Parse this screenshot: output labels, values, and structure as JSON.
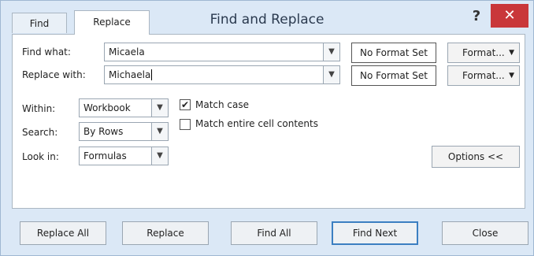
{
  "window": {
    "title": "Find and Replace",
    "help_label": "?",
    "close_label": "✕"
  },
  "tabs": [
    {
      "label": "Find",
      "selected": false
    },
    {
      "label": "Replace",
      "selected": true
    }
  ],
  "form": {
    "find_label": "Find what:",
    "find_value": "Micaela",
    "replace_label": "Replace with:",
    "replace_value": "Michaela",
    "format_status_1": "No Format Set",
    "format_status_2": "No Format Set",
    "format_button_1": "Format...",
    "format_button_2": "Format...",
    "within_label": "Within:",
    "within_value": "Workbook",
    "search_label": "Search:",
    "search_value": "By Rows",
    "lookin_label": "Look in:",
    "lookin_value": "Formulas",
    "match_case_label": "Match case",
    "match_case_checked": true,
    "match_entire_label": "Match entire cell contents",
    "match_entire_checked": false,
    "options_button": "Options <<"
  },
  "buttons": {
    "replace_all": "Replace All",
    "replace": "Replace",
    "find_all": "Find All",
    "find_next": "Find Next",
    "close": "Close"
  },
  "colors": {
    "window_bg": "#dbe8f6",
    "close_red": "#c9373a",
    "default_button_border": "#3c7fc1"
  },
  "icons": {
    "dropdown": "chevron-down-icon",
    "checkmark": "checkmark-icon"
  }
}
